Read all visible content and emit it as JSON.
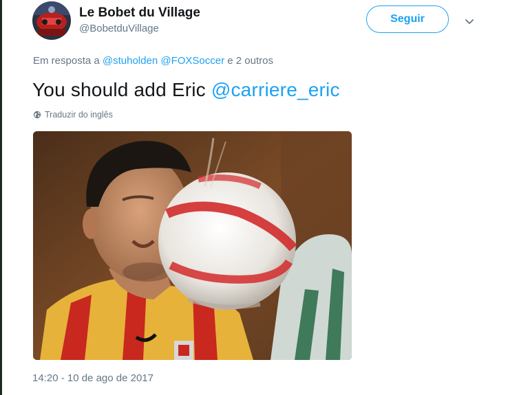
{
  "user": {
    "display_name": "Le Bobet du Village",
    "handle": "@BobetduVillage",
    "avatar_icon": "profile-avatar"
  },
  "actions": {
    "follow_label": "Seguir",
    "menu_icon": "chevron-down-icon"
  },
  "reply": {
    "prefix": "Em resposta a",
    "mention_1": "@stuholden",
    "mention_2": "@FOXSoccer",
    "suffix": "e 2 outros"
  },
  "tweet": {
    "text": "You should add Eric",
    "mention": "@carriere_eric"
  },
  "translate": {
    "label": "Traduzir do inglês",
    "icon": "globe-icon"
  },
  "media": {
    "icon": "photo-soccer-player-hit-by-ball"
  },
  "timestamp": "14:20 - 10 de ago de 2017",
  "colors": {
    "accent": "#1da1f2",
    "text": "#14171a",
    "secondary": "#657786"
  }
}
